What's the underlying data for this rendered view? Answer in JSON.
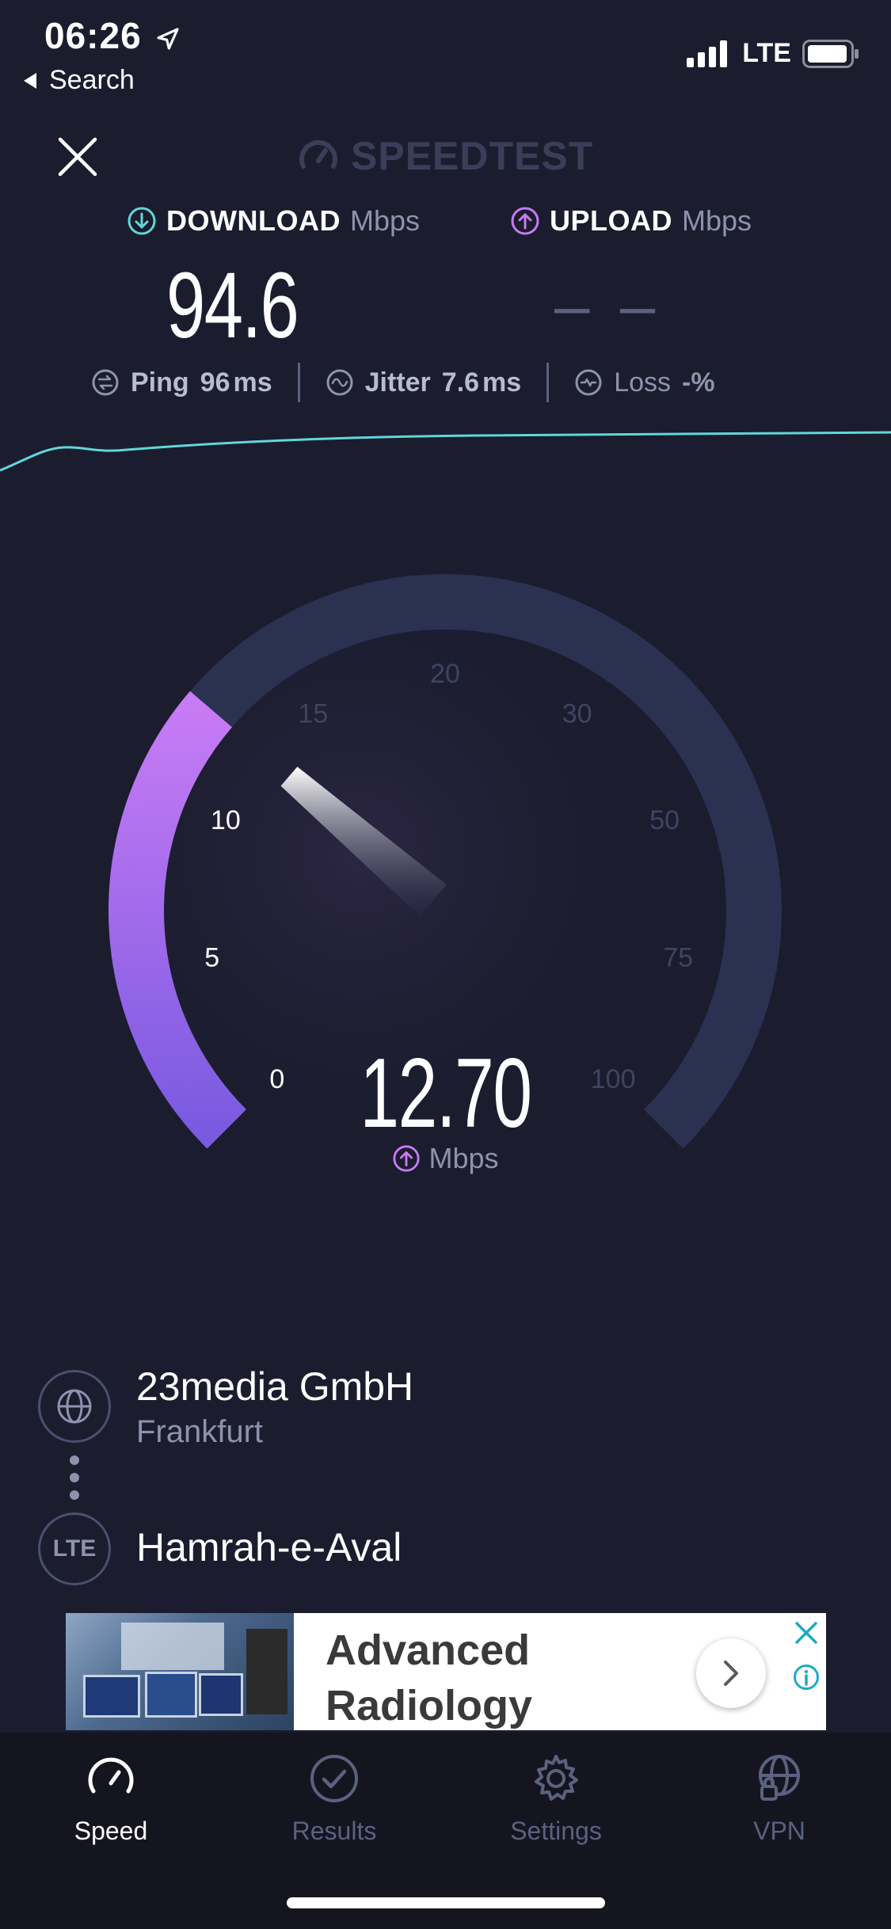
{
  "status_bar": {
    "time": "06:26",
    "back_label": "Search",
    "network": "LTE"
  },
  "header": {
    "app_name": "SPEEDTEST"
  },
  "download": {
    "label": "DOWNLOAD",
    "unit": "Mbps",
    "value": "94.6"
  },
  "upload": {
    "label": "UPLOAD",
    "unit": "Mbps",
    "value": "– –"
  },
  "stats": {
    "ping_label": "Ping",
    "ping_value": "96",
    "ping_unit": "ms",
    "jitter_label": "Jitter",
    "jitter_value": "7.6",
    "jitter_unit": "ms",
    "loss_label": "Loss",
    "loss_value": "-",
    "loss_unit": "%"
  },
  "gauge": {
    "current_value": "12.70",
    "unit": "Mbps",
    "current_numeric": 12.7,
    "scale_labels": [
      "0",
      "5",
      "10",
      "15",
      "20",
      "30",
      "50",
      "75",
      "100"
    ],
    "colors": {
      "track": "#2b3150",
      "active_start": "#c77bf5",
      "active_end": "#7a5ae0",
      "upload_accent": "#c77bf5",
      "download_accent": "#5fd8d8"
    }
  },
  "server": {
    "host": "23media GmbH",
    "city": "Frankfurt",
    "isp": "Hamrah-e-Aval",
    "isp_badge": "LTE"
  },
  "ad": {
    "title": "Advanced Radiology"
  },
  "tabs": [
    {
      "label": "Speed",
      "icon": "speed-icon",
      "active": true
    },
    {
      "label": "Results",
      "icon": "results-icon",
      "active": false
    },
    {
      "label": "Settings",
      "icon": "settings-icon",
      "active": false
    },
    {
      "label": "VPN",
      "icon": "vpn-icon",
      "active": false
    }
  ]
}
